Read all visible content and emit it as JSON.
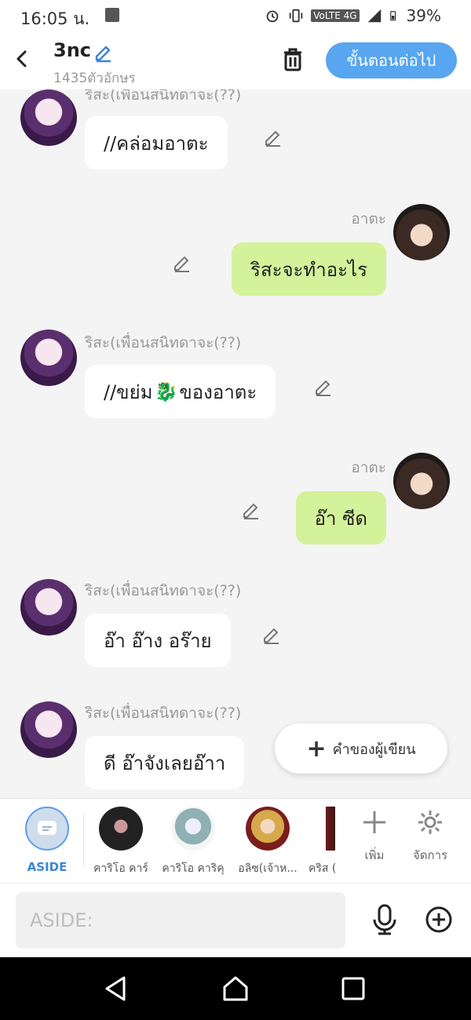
{
  "status_bar": {
    "time": "16:05 น.",
    "network": "VoLTE 4G",
    "battery": "39%"
  },
  "header": {
    "title": "3nc",
    "char_count": "1435ตัวอักษร",
    "next_button": "ขั้นตอนต่อไป"
  },
  "messages": [
    {
      "side": "left",
      "name": "ริสะ(เพื่อนสนิทดาจะ(??)",
      "text": "//คล่อมอาตะ"
    },
    {
      "side": "right",
      "name": "อาตะ",
      "text": "ริสะจะทำอะไร"
    },
    {
      "side": "left",
      "name": "ริสะ(เพื่อนสนิทดาจะ(??)",
      "text": "//ขย่ม",
      "emoji": "🐉",
      "text2": "ของอาตะ"
    },
    {
      "side": "right",
      "name": "อาตะ",
      "text": "อ๊า ซีด"
    },
    {
      "side": "left",
      "name": "ริสะ(เพื่อนสนิทดาจะ(??)",
      "text": "อ๊า อ๊าง อร๊าย"
    },
    {
      "side": "left",
      "name": "ริสะ(เพื่อนสนิทดาจะ(??)",
      "text": "ดี อ๊าจังเลยอ๊าา"
    }
  ],
  "fab": {
    "label": "คำของผู้เขียน"
  },
  "characters": {
    "aside_label": "ASIDE",
    "items": [
      "คาริโอ คาร์",
      "คาริโอ คาริคุ",
      "อลิซ(เจ้าห...",
      "คริส (..."
    ],
    "add_label": "เพิ่ม",
    "manage_label": "จัดการ"
  },
  "input": {
    "placeholder": "ASIDE:"
  },
  "colors": {
    "accent": "#58a6ef",
    "right_bubble": "#d4f29a",
    "left_bubble": "#ffffff"
  }
}
